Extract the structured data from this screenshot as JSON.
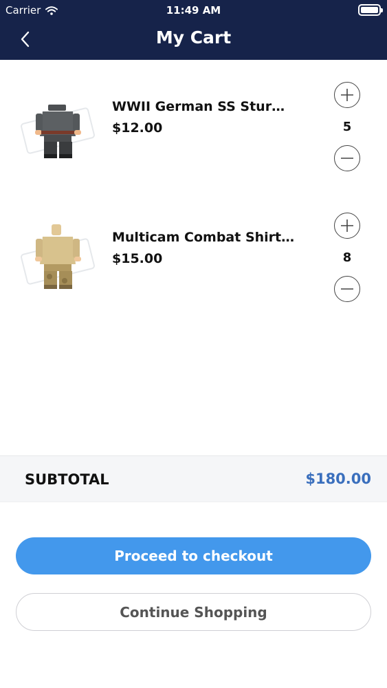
{
  "status_bar": {
    "carrier": "Carrier",
    "time": "11:49 AM"
  },
  "nav": {
    "title": "My Cart"
  },
  "cart": {
    "items": [
      {
        "name": "WWII German SS Sturmb...",
        "price": "$12.00",
        "quantity": "5"
      },
      {
        "name": "Multicam Combat Shirt/L...",
        "price": "$15.00",
        "quantity": "8"
      }
    ]
  },
  "summary": {
    "subtotal_label": "SUBTOTAL",
    "subtotal_value": "$180.00"
  },
  "actions": {
    "checkout_label": "Proceed to checkout",
    "continue_label": "Continue Shopping"
  },
  "colors": {
    "header_bg": "#16234a",
    "accent": "#4398ec",
    "price_accent": "#3a6fbd"
  }
}
